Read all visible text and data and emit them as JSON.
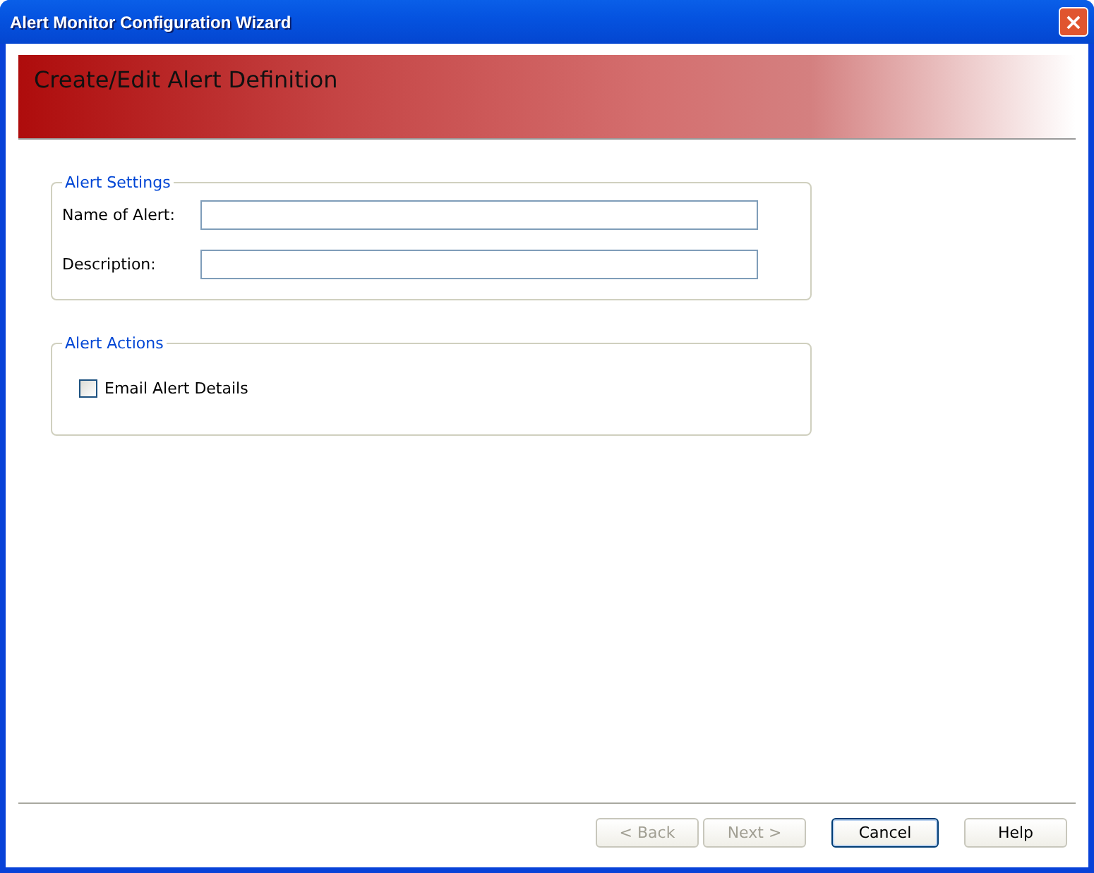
{
  "window": {
    "title": "Alert Monitor Configuration Wizard",
    "close": "×"
  },
  "header": {
    "title": "Create/Edit Alert Definition"
  },
  "groups": [
    {
      "title": "Alert Settings",
      "kind": "fields",
      "fields": [
        {
          "label": "Name of Alert:"
        },
        {
          "label": "Description:"
        }
      ]
    },
    {
      "title": "Alert Actions",
      "kind": "checks",
      "checks": [
        {
          "label": "Email Alert Details",
          "checked": false
        }
      ]
    }
  ],
  "buttons": [
    {
      "label": "< Back",
      "disabled": true,
      "default": false
    },
    {
      "label": "Next >",
      "disabled": true,
      "default": false
    },
    {
      "label": "Cancel",
      "disabled": false,
      "default": true
    },
    {
      "label": "Help",
      "disabled": false,
      "default": false
    }
  ]
}
